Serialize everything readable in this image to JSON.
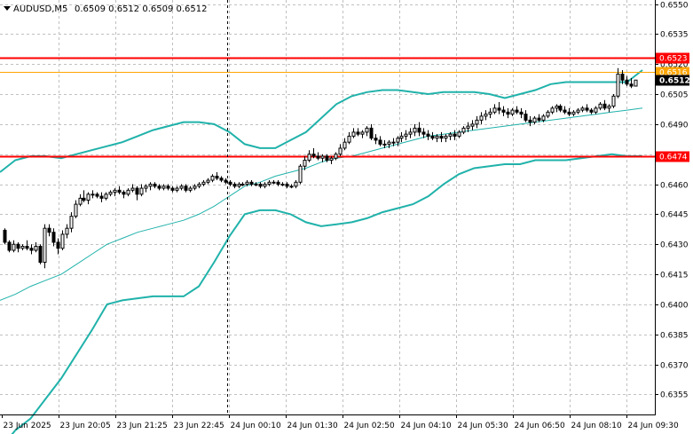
{
  "chart_data": {
    "type": "candlestick",
    "symbol_label": "AUDUSD,M5",
    "ohlc_label": "0.6509 0.6512 0.6509 0.6512",
    "current_price_label": "0.6512",
    "ylim": [
      0.6345,
      0.6552
    ],
    "y_ticks": [
      "0.6550",
      "0.6535",
      "0.6520",
      "0.6505",
      "0.6490",
      "0.6475",
      "0.6460",
      "0.6445",
      "0.6430",
      "0.6415",
      "0.6400",
      "0.6385",
      "0.6370",
      "0.6355"
    ],
    "x_tick_labels": [
      "23 Jun 2025",
      "23 Jun 20:05",
      "23 Jun 21:25",
      "23 Jun 22:45",
      "24 Jun 00:10",
      "24 Jun 01:30",
      "24 Jun 02:50",
      "24 Jun 04:10",
      "24 Jun 05:30",
      "24 Jun 06:50",
      "24 Jun 08:10",
      "24 Jun 09:30"
    ],
    "horizontal_lines": [
      {
        "value": 0.6523,
        "label": "0.6523",
        "color": "#ff0000"
      },
      {
        "value": 0.6474,
        "label": "0.6474",
        "color": "#ff0000"
      },
      {
        "value": 0.6516,
        "label": "0.6516",
        "color": "#ffa500"
      }
    ],
    "colors": {
      "candle": "#000000",
      "bollinger": "#20b2aa",
      "grid": "#c0c0c0",
      "session_separator": "#000000",
      "resistance": "#ff0000",
      "bid_line": "#ffa500"
    },
    "indicator": {
      "type": "bollinger_bands",
      "upper": [
        0.6466,
        0.6472,
        0.6474,
        0.6474,
        0.6473,
        0.6475,
        0.6477,
        0.6479,
        0.6481,
        0.6484,
        0.6487,
        0.6489,
        0.6491,
        0.6491,
        0.649,
        0.6486,
        0.648,
        0.6478,
        0.6478,
        0.6482,
        0.6486,
        0.6493,
        0.65,
        0.6504,
        0.6506,
        0.6507,
        0.6507,
        0.6506,
        0.6505,
        0.6506,
        0.6506,
        0.6506,
        0.6505,
        0.6503,
        0.6505,
        0.6507,
        0.651,
        0.6511,
        0.6511,
        0.6511,
        0.6511,
        0.6511,
        0.6517
      ],
      "middle": [
        0.6402,
        0.6405,
        0.6409,
        0.6412,
        0.6415,
        0.642,
        0.6425,
        0.643,
        0.6433,
        0.6436,
        0.6438,
        0.644,
        0.6442,
        0.6445,
        0.6449,
        0.6454,
        0.6459,
        0.6461,
        0.6464,
        0.6466,
        0.6468,
        0.6471,
        0.6473,
        0.6474,
        0.6476,
        0.6478,
        0.648,
        0.6482,
        0.6484,
        0.6485,
        0.6486,
        0.6487,
        0.6488,
        0.6489,
        0.649,
        0.6491,
        0.6492,
        0.6493,
        0.6494,
        0.6495,
        0.6496,
        0.6497,
        0.6498
      ],
      "lower": [
        0.6328,
        0.6337,
        0.6343,
        0.6353,
        0.6363,
        0.6375,
        0.6387,
        0.64,
        0.6402,
        0.6403,
        0.6404,
        0.6404,
        0.6404,
        0.6409,
        0.6421,
        0.6434,
        0.6445,
        0.6447,
        0.6447,
        0.6445,
        0.6441,
        0.6439,
        0.644,
        0.6441,
        0.6443,
        0.6446,
        0.6448,
        0.645,
        0.6454,
        0.646,
        0.6465,
        0.6468,
        0.6469,
        0.647,
        0.647,
        0.6472,
        0.6472,
        0.6472,
        0.6473,
        0.6474,
        0.6475,
        0.6474,
        0.6474
      ]
    },
    "candles": [
      [
        0.6437,
        0.6438,
        0.643,
        0.6431
      ],
      [
        0.6431,
        0.6432,
        0.6426,
        0.6427
      ],
      [
        0.6427,
        0.6432,
        0.6426,
        0.643
      ],
      [
        0.643,
        0.6431,
        0.6426,
        0.6428
      ],
      [
        0.6428,
        0.643,
        0.6427,
        0.6429
      ],
      [
        0.6429,
        0.6432,
        0.6427,
        0.6428
      ],
      [
        0.6428,
        0.643,
        0.6425,
        0.6427
      ],
      [
        0.6427,
        0.6431,
        0.6426,
        0.6429
      ],
      [
        0.6429,
        0.643,
        0.642,
        0.6421
      ],
      [
        0.6421,
        0.644,
        0.6418,
        0.6438
      ],
      [
        0.6438,
        0.644,
        0.6434,
        0.6436
      ],
      [
        0.6436,
        0.6438,
        0.6429,
        0.6431
      ],
      [
        0.6431,
        0.6433,
        0.6425,
        0.6428
      ],
      [
        0.6428,
        0.6437,
        0.6427,
        0.6435
      ],
      [
        0.6435,
        0.644,
        0.6433,
        0.6438
      ],
      [
        0.6438,
        0.6446,
        0.6436,
        0.6444
      ],
      [
        0.6444,
        0.6452,
        0.6443,
        0.645
      ],
      [
        0.645,
        0.6455,
        0.6449,
        0.6453
      ],
      [
        0.6453,
        0.6457,
        0.6451,
        0.6452
      ],
      [
        0.6452,
        0.6456,
        0.645,
        0.6455
      ],
      [
        0.6455,
        0.6457,
        0.6453,
        0.6455
      ],
      [
        0.6455,
        0.6456,
        0.6453,
        0.6454
      ],
      [
        0.6454,
        0.6456,
        0.6451,
        0.6453
      ],
      [
        0.6453,
        0.6456,
        0.6452,
        0.6455
      ],
      [
        0.6455,
        0.6457,
        0.6454,
        0.6456
      ],
      [
        0.6456,
        0.6458,
        0.6454,
        0.6457
      ],
      [
        0.6457,
        0.6459,
        0.6455,
        0.6456
      ],
      [
        0.6456,
        0.6457,
        0.6453,
        0.6455
      ],
      [
        0.6455,
        0.6458,
        0.6454,
        0.6457
      ],
      [
        0.6457,
        0.646,
        0.6456,
        0.6458
      ],
      [
        0.6458,
        0.6459,
        0.6452,
        0.6455
      ],
      [
        0.6455,
        0.646,
        0.6454,
        0.6458
      ],
      [
        0.6458,
        0.646,
        0.6456,
        0.6459
      ],
      [
        0.6459,
        0.6461,
        0.6457,
        0.646
      ],
      [
        0.646,
        0.6461,
        0.6458,
        0.6459
      ],
      [
        0.6459,
        0.646,
        0.6457,
        0.6458
      ],
      [
        0.6458,
        0.646,
        0.6457,
        0.6459
      ],
      [
        0.6459,
        0.646,
        0.6457,
        0.6458
      ],
      [
        0.6458,
        0.6459,
        0.6456,
        0.6457
      ],
      [
        0.6457,
        0.6459,
        0.6456,
        0.6458
      ],
      [
        0.6458,
        0.646,
        0.6457,
        0.6459
      ],
      [
        0.6459,
        0.646,
        0.6456,
        0.6457
      ],
      [
        0.6457,
        0.6459,
        0.6456,
        0.6458
      ],
      [
        0.6458,
        0.646,
        0.6457,
        0.6459
      ],
      [
        0.6459,
        0.6461,
        0.6458,
        0.646
      ],
      [
        0.646,
        0.6462,
        0.6459,
        0.6461
      ],
      [
        0.6461,
        0.6463,
        0.646,
        0.6462
      ],
      [
        0.6462,
        0.6465,
        0.6461,
        0.6464
      ],
      [
        0.6464,
        0.6466,
        0.6462,
        0.6463
      ],
      [
        0.6463,
        0.6464,
        0.6461,
        0.6462
      ],
      [
        0.6462,
        0.6463,
        0.646,
        0.6461
      ],
      [
        0.6461,
        0.6462,
        0.6459,
        0.646
      ],
      [
        0.646,
        0.6461,
        0.6458,
        0.6459
      ],
      [
        0.6459,
        0.6461,
        0.6458,
        0.646
      ],
      [
        0.646,
        0.6461,
        0.6459,
        0.646
      ],
      [
        0.646,
        0.6462,
        0.6459,
        0.6461
      ],
      [
        0.6461,
        0.6462,
        0.6459,
        0.646
      ],
      [
        0.646,
        0.6461,
        0.6459,
        0.646
      ],
      [
        0.646,
        0.6461,
        0.6458,
        0.6459
      ],
      [
        0.6459,
        0.6461,
        0.6458,
        0.646
      ],
      [
        0.646,
        0.6462,
        0.6459,
        0.6461
      ],
      [
        0.6461,
        0.6462,
        0.646,
        0.6461
      ],
      [
        0.6461,
        0.6462,
        0.6459,
        0.646
      ],
      [
        0.646,
        0.6461,
        0.6459,
        0.646
      ],
      [
        0.646,
        0.6461,
        0.6458,
        0.6459
      ],
      [
        0.6459,
        0.646,
        0.6458,
        0.6459
      ],
      [
        0.6459,
        0.6462,
        0.6458,
        0.6461
      ],
      [
        0.6461,
        0.647,
        0.646,
        0.6469
      ],
      [
        0.6469,
        0.6474,
        0.6467,
        0.6472
      ],
      [
        0.6472,
        0.6477,
        0.6471,
        0.6475
      ],
      [
        0.6475,
        0.6478,
        0.6473,
        0.6474
      ],
      [
        0.6474,
        0.6476,
        0.6472,
        0.6473
      ],
      [
        0.6473,
        0.6475,
        0.6471,
        0.6474
      ],
      [
        0.6474,
        0.6475,
        0.6471,
        0.6472
      ],
      [
        0.6472,
        0.6474,
        0.647,
        0.6473
      ],
      [
        0.6473,
        0.6476,
        0.6472,
        0.6475
      ],
      [
        0.6475,
        0.648,
        0.6474,
        0.6478
      ],
      [
        0.6478,
        0.6483,
        0.6477,
        0.6481
      ],
      [
        0.6481,
        0.6486,
        0.648,
        0.6484
      ],
      [
        0.6484,
        0.6488,
        0.6483,
        0.6486
      ],
      [
        0.6486,
        0.6488,
        0.6484,
        0.6485
      ],
      [
        0.6485,
        0.6487,
        0.6483,
        0.6486
      ],
      [
        0.6486,
        0.6489,
        0.6484,
        0.6488
      ],
      [
        0.6488,
        0.649,
        0.6482,
        0.6483
      ],
      [
        0.6483,
        0.6485,
        0.648,
        0.6482
      ],
      [
        0.6482,
        0.6484,
        0.6479,
        0.648
      ],
      [
        0.648,
        0.6482,
        0.6478,
        0.648
      ],
      [
        0.648,
        0.6482,
        0.6478,
        0.6481
      ],
      [
        0.6481,
        0.6483,
        0.6479,
        0.6481
      ],
      [
        0.6481,
        0.6484,
        0.6479,
        0.6483
      ],
      [
        0.6483,
        0.6486,
        0.6481,
        0.6484
      ],
      [
        0.6484,
        0.6487,
        0.6482,
        0.6485
      ],
      [
        0.6485,
        0.6488,
        0.6483,
        0.6486
      ],
      [
        0.6486,
        0.649,
        0.6484,
        0.6488
      ],
      [
        0.6488,
        0.6491,
        0.6484,
        0.6486
      ],
      [
        0.6486,
        0.6488,
        0.6483,
        0.6485
      ],
      [
        0.6485,
        0.6487,
        0.6482,
        0.6484
      ],
      [
        0.6484,
        0.6486,
        0.6482,
        0.6483
      ],
      [
        0.6483,
        0.6485,
        0.6481,
        0.6484
      ],
      [
        0.6484,
        0.6486,
        0.6481,
        0.6483
      ],
      [
        0.6483,
        0.6485,
        0.6481,
        0.6484
      ],
      [
        0.6484,
        0.6486,
        0.6482,
        0.6485
      ],
      [
        0.6485,
        0.6487,
        0.6482,
        0.6484
      ],
      [
        0.6484,
        0.6487,
        0.6483,
        0.6486
      ],
      [
        0.6486,
        0.6489,
        0.6485,
        0.6488
      ],
      [
        0.6488,
        0.6491,
        0.6486,
        0.6489
      ],
      [
        0.6489,
        0.6492,
        0.6487,
        0.649
      ],
      [
        0.649,
        0.6494,
        0.6488,
        0.6492
      ],
      [
        0.6492,
        0.6496,
        0.649,
        0.6494
      ],
      [
        0.6494,
        0.6497,
        0.6492,
        0.6495
      ],
      [
        0.6495,
        0.6498,
        0.6493,
        0.6496
      ],
      [
        0.6496,
        0.65,
        0.6495,
        0.6498
      ],
      [
        0.6498,
        0.6501,
        0.6495,
        0.6497
      ],
      [
        0.6497,
        0.6499,
        0.6494,
        0.6496
      ],
      [
        0.6496,
        0.6498,
        0.6493,
        0.6495
      ],
      [
        0.6495,
        0.6498,
        0.6494,
        0.6497
      ],
      [
        0.6497,
        0.6499,
        0.6495,
        0.6496
      ],
      [
        0.6496,
        0.6498,
        0.6493,
        0.6495
      ],
      [
        0.6495,
        0.6497,
        0.6491,
        0.6492
      ],
      [
        0.6492,
        0.6494,
        0.6489,
        0.6491
      ],
      [
        0.6491,
        0.6494,
        0.649,
        0.6493
      ],
      [
        0.6493,
        0.6495,
        0.6491,
        0.6492
      ],
      [
        0.6492,
        0.6495,
        0.6491,
        0.6494
      ],
      [
        0.6494,
        0.6497,
        0.6493,
        0.6496
      ],
      [
        0.6496,
        0.6499,
        0.6495,
        0.6498
      ],
      [
        0.6498,
        0.65,
        0.6496,
        0.6499
      ],
      [
        0.6499,
        0.65,
        0.6496,
        0.6497
      ],
      [
        0.6497,
        0.6499,
        0.6495,
        0.6496
      ],
      [
        0.6496,
        0.6498,
        0.6494,
        0.6495
      ],
      [
        0.6495,
        0.6497,
        0.6494,
        0.6496
      ],
      [
        0.6496,
        0.6498,
        0.6495,
        0.6497
      ],
      [
        0.6497,
        0.6499,
        0.6496,
        0.6498
      ],
      [
        0.6498,
        0.65,
        0.6496,
        0.6497
      ],
      [
        0.6497,
        0.6498,
        0.6495,
        0.6496
      ],
      [
        0.6496,
        0.6499,
        0.6495,
        0.6498
      ],
      [
        0.6498,
        0.6501,
        0.6497,
        0.65
      ],
      [
        0.65,
        0.6502,
        0.6497,
        0.6498
      ],
      [
        0.6498,
        0.65,
        0.6496,
        0.6499
      ],
      [
        0.6499,
        0.6505,
        0.6498,
        0.6504
      ],
      [
        0.6504,
        0.6518,
        0.6503,
        0.6515
      ],
      [
        0.6515,
        0.6517,
        0.651,
        0.6512
      ],
      [
        0.6512,
        0.6514,
        0.6509,
        0.651
      ],
      [
        0.651,
        0.6513,
        0.6508,
        0.6509
      ],
      [
        0.6509,
        0.6512,
        0.6509,
        0.6512
      ]
    ]
  }
}
